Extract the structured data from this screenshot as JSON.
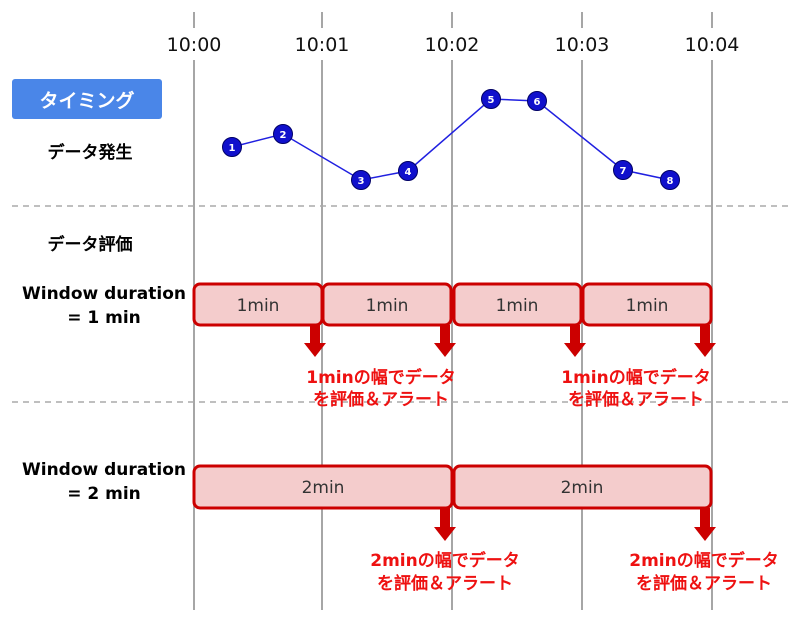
{
  "time_ticks": [
    "10:00",
    "10:01",
    "10:02",
    "10:03",
    "10:04"
  ],
  "timing_label": "タイミング",
  "data_generation_label": "データ発生",
  "data_evaluation_label": "データ評価",
  "points": [
    "1",
    "2",
    "3",
    "4",
    "5",
    "6",
    "7",
    "8"
  ],
  "window_1min": {
    "title_line1": "Window duration",
    "title_line2": "= 1 min",
    "windows": [
      "1min",
      "1min",
      "1min",
      "1min"
    ],
    "alert_line1": "1minの幅でデータ",
    "alert_line2": "を評価＆アラート"
  },
  "window_2min": {
    "title_line1": "Window duration",
    "title_line2": "= 2 min",
    "windows": [
      "2min",
      "2min"
    ],
    "alert_line1": "2minの幅でデータ",
    "alert_line2": "を評価＆アラート"
  },
  "colors": {
    "badge": "#4a86e8",
    "point_fill": "#1010cc",
    "line": "#2020e0",
    "window_fill": "#f4cccc",
    "window_stroke": "#cc0000",
    "arrow": "#cc0000",
    "alert_text": "#ee1111"
  }
}
